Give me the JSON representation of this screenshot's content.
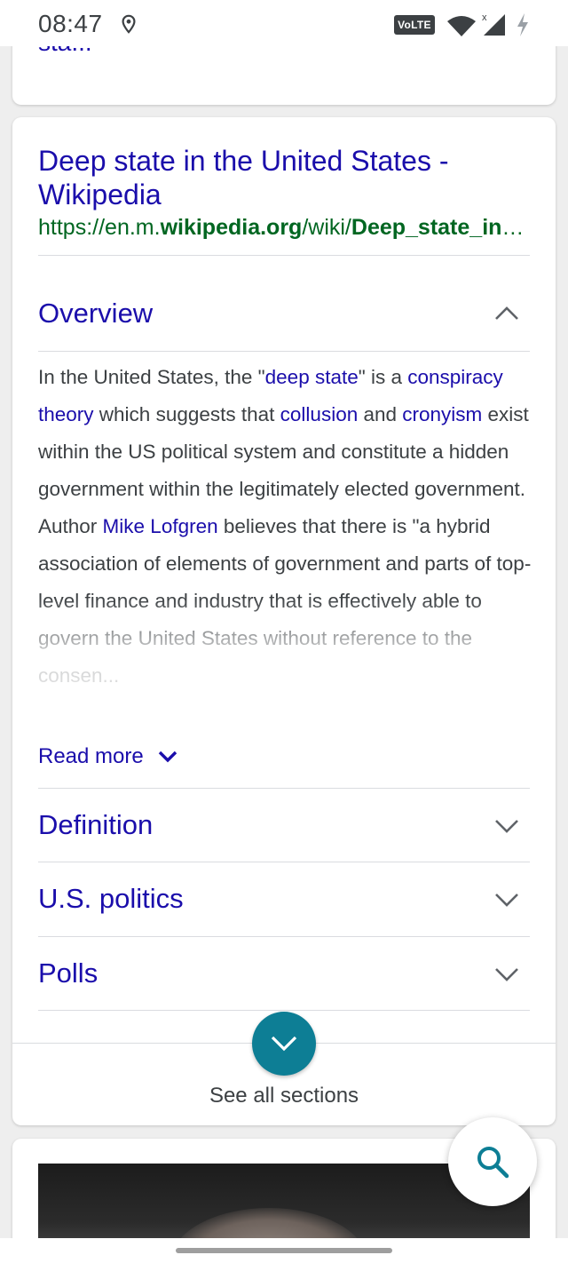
{
  "status_bar": {
    "time": "08:47",
    "volte_label": "VoLTE",
    "icons": [
      "location-icon",
      "wifi-icon",
      "signal-icon",
      "battery-charging-icon"
    ]
  },
  "previous_result": {
    "title_fragment": "sta..."
  },
  "result": {
    "title": "Deep state in the United States - Wikipedia",
    "url_prefix": "https://en.m.",
    "url_domain": "wikipedia.org",
    "url_path": "/wiki/",
    "url_page": "Deep_state_in_the_United_States"
  },
  "overview": {
    "header": "Overview",
    "expanded": true,
    "text": [
      {
        "t": "In the United States, the \"",
        "link": false
      },
      {
        "t": "deep state",
        "link": true
      },
      {
        "t": "\" is a ",
        "link": false
      },
      {
        "t": "conspiracy theory",
        "link": true
      },
      {
        "t": " which suggests that ",
        "link": false
      },
      {
        "t": "collusion",
        "link": true
      },
      {
        "t": " and ",
        "link": false
      },
      {
        "t": "cronyism",
        "link": true
      },
      {
        "t": " exist within the US political system and constitute a hidden government within the legitimately elected government. Author ",
        "link": false
      },
      {
        "t": "Mike Lofgren",
        "link": true
      },
      {
        "t": " believes that there is \"a hybrid association of elements of government and parts of top-level finance and industry that is effectively able to govern the United States without reference to the consen...",
        "link": false
      }
    ],
    "read_more": "Read more"
  },
  "sections": [
    {
      "label": "Definition",
      "name": "section-definition"
    },
    {
      "label": "U.S. politics",
      "name": "section-us-politics"
    },
    {
      "label": "Polls",
      "name": "section-polls"
    }
  ],
  "see_all": {
    "label": "See all sections"
  },
  "colors": {
    "link": "#1a0dab",
    "url_green": "#006621",
    "accent_teal": "#0d7e95"
  }
}
